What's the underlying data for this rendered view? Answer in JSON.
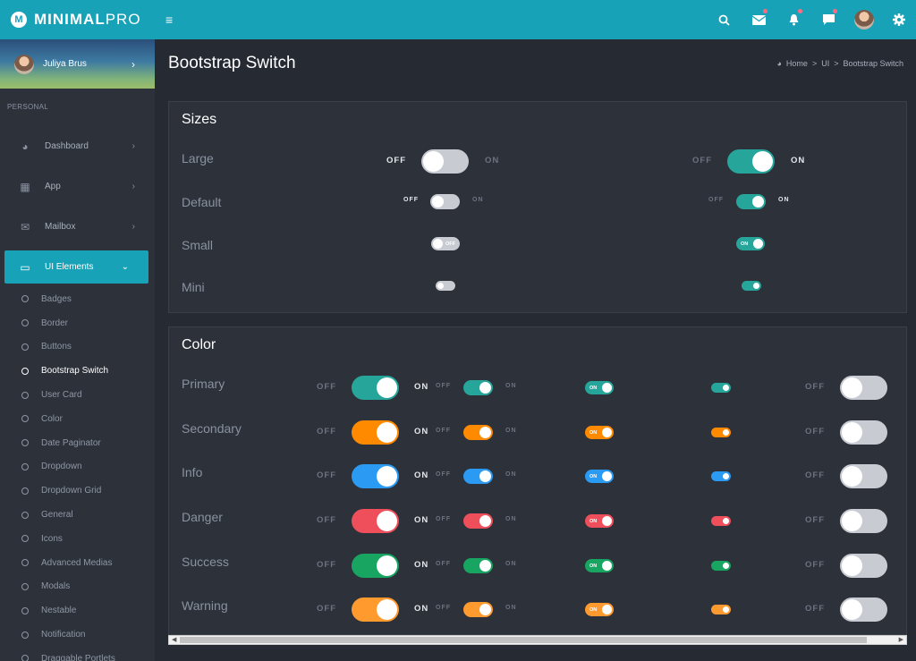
{
  "brand": {
    "name_bold": "MINIMAL",
    "name_light": "PRO",
    "logo_letter": "M"
  },
  "topbar": {
    "menu_icon": "menu-icon",
    "icons": [
      "search-icon",
      "mail-icon",
      "bell-icon",
      "chat-icon",
      "avatar",
      "gear-icon"
    ]
  },
  "sidebar": {
    "user_name": "Juliya Brus",
    "section": "PERSONAL",
    "items": [
      {
        "label": "Dashboard",
        "icon": "dashboard-icon",
        "glyph": "◕"
      },
      {
        "label": "App",
        "icon": "grid-icon",
        "glyph": "▦"
      },
      {
        "label": "Mailbox",
        "icon": "mail-icon",
        "glyph": "✉"
      },
      {
        "label": "UI Elements",
        "icon": "laptop-icon",
        "glyph": "▭"
      }
    ],
    "sub_items": [
      "Badges",
      "Border",
      "Buttons",
      "Bootstrap Switch",
      "User Card",
      "Color",
      "Date Paginator",
      "Dropdown",
      "Dropdown Grid",
      "General",
      "Icons",
      "Advanced Medias",
      "Modals",
      "Nestable",
      "Notification",
      "Draggable Portlets"
    ],
    "current_sub": "Bootstrap Switch"
  },
  "header": {
    "title": "Bootstrap Switch",
    "breadcrumb": [
      "Home",
      "UI",
      "Bootstrap Switch"
    ],
    "sep": ">"
  },
  "sizes": {
    "title": "Sizes",
    "rows": [
      "Large",
      "Default",
      "Small",
      "Mini"
    ],
    "off": "OFF",
    "on": "ON"
  },
  "color": {
    "title": "Color",
    "rows": [
      {
        "label": "Primary",
        "color": "#26a69a"
      },
      {
        "label": "Secondary",
        "color": "#ff8a00"
      },
      {
        "label": "Info",
        "color": "#2b9af3"
      },
      {
        "label": "Danger",
        "color": "#ef4f5b"
      },
      {
        "label": "Success",
        "color": "#17a561"
      },
      {
        "label": "Warning",
        "color": "#ff9a2e"
      }
    ],
    "off": "OFF",
    "on": "ON"
  },
  "colors": {
    "accent": "#17a2b8",
    "off_switch": "#c8ccd2"
  }
}
